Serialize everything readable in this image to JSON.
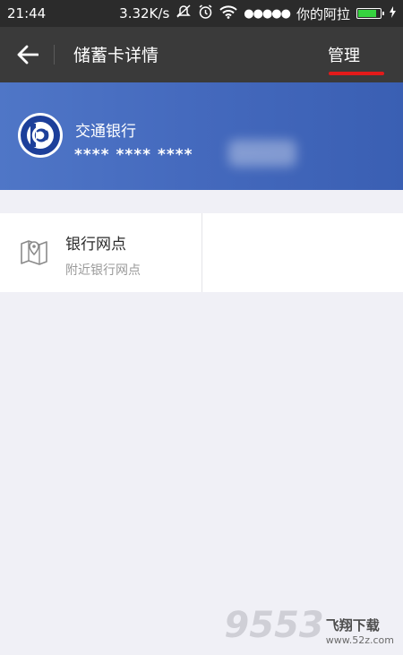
{
  "status_bar": {
    "time": "21:44",
    "speed": "3.32K/s",
    "carrier": "你的阿拉",
    "battery_level": 0.85,
    "battery_color": "#36d33f",
    "icons": [
      "mute-icon",
      "alarm-icon",
      "wifi-icon",
      "signal-icon",
      "battery-icon",
      "charging-icon"
    ]
  },
  "nav": {
    "back_icon": "back-arrow-icon",
    "title": "储蓄卡详情",
    "manage_label": "管理",
    "highlight_color": "#e21a1a"
  },
  "card": {
    "bank_name": "交通银行",
    "card_number": "**** **** ****",
    "logo_icon": "bank-of-communications-logo"
  },
  "services": [
    {
      "icon": "map-icon",
      "title": "银行网点",
      "subtitle": "附近银行网点"
    }
  ],
  "watermark": {
    "logo": "9553",
    "text": "飞翔下载",
    "url": "www.52z.com"
  }
}
